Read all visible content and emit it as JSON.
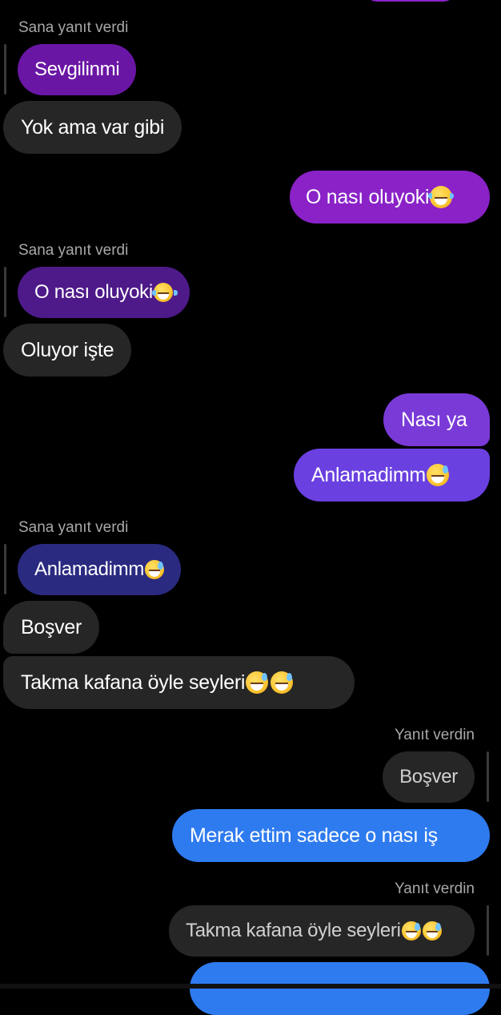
{
  "colors": {
    "background": "#000000",
    "incoming_bubble": "#262626",
    "outgoing_purple": "#8a22c8",
    "outgoing_indigo": "#6a40e0",
    "outgoing_blue": "#2e7bf0"
  },
  "messages": [
    {
      "reply_caption": "Sana yanıt verdi",
      "quoted_text": "Sevgilinmi",
      "text": "Yok ama var gibi"
    },
    {
      "text": "O nası oluyoki",
      "emoji": "face-with-tears-of-joy-icon"
    },
    {
      "reply_caption": "Sana yanıt verdi",
      "quoted_text": "O nası oluyoki",
      "quoted_emoji": "face-with-tears-of-joy-icon",
      "text": "Oluyor işte"
    },
    {
      "text": "Nası ya"
    },
    {
      "text": "Anlamadimm",
      "emoji": "grinning-face-with-sweat-icon"
    },
    {
      "reply_caption": "Sana yanıt verdi",
      "quoted_text": "Anlamadimm",
      "quoted_emoji": "grinning-face-with-sweat-icon",
      "text": "Boşver"
    },
    {
      "text": "Takma kafana öyle seyleri ",
      "emoji": "grinning-face-with-sweat-icon x2"
    },
    {
      "reply_caption": "Yanıt verdin",
      "quoted_text": "Boşver",
      "text": "Merak ettim sadece o nası iş"
    },
    {
      "reply_caption": "Yanıt verdin",
      "quoted_text": "Takma kafana öyle seyleri ",
      "quoted_emoji": "grinning-face-with-sweat-icon x2"
    }
  ]
}
